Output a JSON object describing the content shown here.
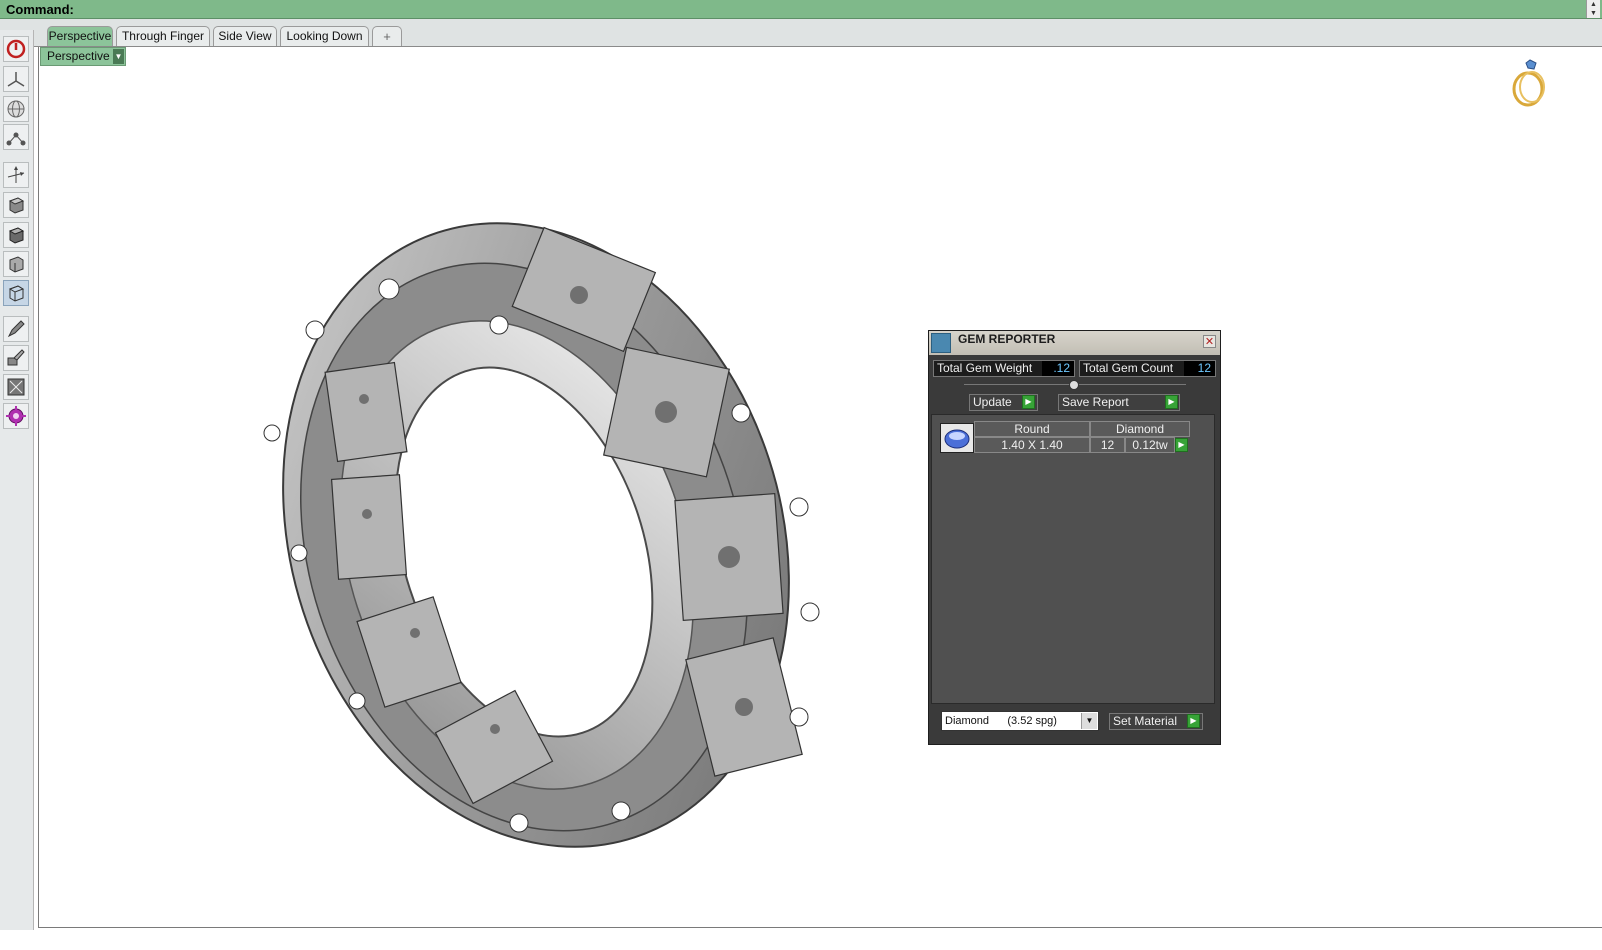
{
  "command_bar": {
    "label": "Command:"
  },
  "tabs": [
    {
      "label": "Perspective",
      "active": true
    },
    {
      "label": "Through Finger",
      "active": false
    },
    {
      "label": "Side View",
      "active": false
    },
    {
      "label": "Looking Down",
      "active": false
    },
    {
      "label": "+",
      "active": false
    }
  ],
  "viewport": {
    "name": "Perspective"
  },
  "toolbar": {
    "icons": [
      "power-icon",
      "axes-icon",
      "globe-icon",
      "nodes-icon",
      "gumball-icon",
      "shaded-cube-icon",
      "rendered-cube-icon",
      "wire-cube-icon",
      "ghost-cube-icon",
      "pen-icon",
      "brush-icon",
      "frame-icon",
      "gear-icon"
    ]
  },
  "gem_reporter": {
    "title": "GEM REPORTER",
    "total_weight_label": "Total Gem Weight",
    "total_weight_value": ".12",
    "total_count_label": "Total Gem Count",
    "total_count_value": "12",
    "update_label": "Update",
    "save_report_label": "Save Report",
    "row": {
      "shape": "Round",
      "material": "Diamond",
      "size": "1.40 X 1.40",
      "count": "12",
      "weight": "0.12tw"
    },
    "material_select": "Diamond      (3.52 spg)",
    "set_material_label": "Set Material"
  },
  "colors": {
    "accent_green": "#8cc49a",
    "command_bar": "#7fb98a",
    "panel_bg": "#3a3a3a",
    "value_text": "#6ec8ff"
  }
}
